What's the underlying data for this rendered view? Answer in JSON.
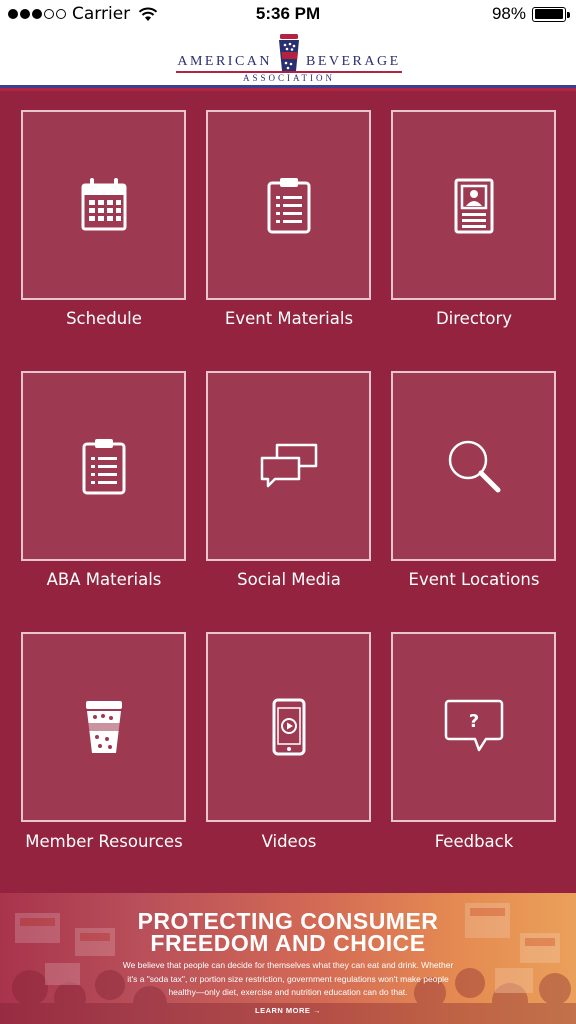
{
  "status_bar": {
    "carrier": "Carrier",
    "time": "5:36 PM",
    "battery": "98%",
    "battery_level": 0.98,
    "signal_bars_filled": 3,
    "signal_bars_total": 5
  },
  "header": {
    "logo_word_left": "AMERICAN",
    "logo_word_right": "BEVERAGE",
    "logo_subtitle": "ASSOCIATION",
    "accent_blue": "#2a2f6f",
    "accent_red": "#b3233f"
  },
  "theme": {
    "background": "#93233e",
    "tile_fill": "#9d3a52",
    "tile_border": "#e8c4cc"
  },
  "tiles": [
    {
      "label": "Schedule",
      "icon": "calendar-icon"
    },
    {
      "label": "Event Materials",
      "icon": "clipboard-icon"
    },
    {
      "label": "Directory",
      "icon": "id-badge-icon"
    },
    {
      "label": "ABA Materials",
      "icon": "clipboard-list-icon"
    },
    {
      "label": "Social Media",
      "icon": "chat-bubbles-icon"
    },
    {
      "label": "Event Locations",
      "icon": "magnifier-icon"
    },
    {
      "label": "Member Resources",
      "icon": "cup-icon"
    },
    {
      "label": "Videos",
      "icon": "phone-video-icon"
    },
    {
      "label": "Feedback",
      "icon": "question-bubble-icon"
    }
  ],
  "banner": {
    "title_line1": "PROTECTING CONSUMER",
    "title_line2": "FREEDOM AND CHOICE",
    "body": "We believe that people can decide for themselves what they can eat and drink. Whether it's a \"soda tax\", or portion size restriction, government regulations won't make people healthy—only diet, exercise and nutrition education can do that.",
    "cta": "LEARN MORE →"
  }
}
